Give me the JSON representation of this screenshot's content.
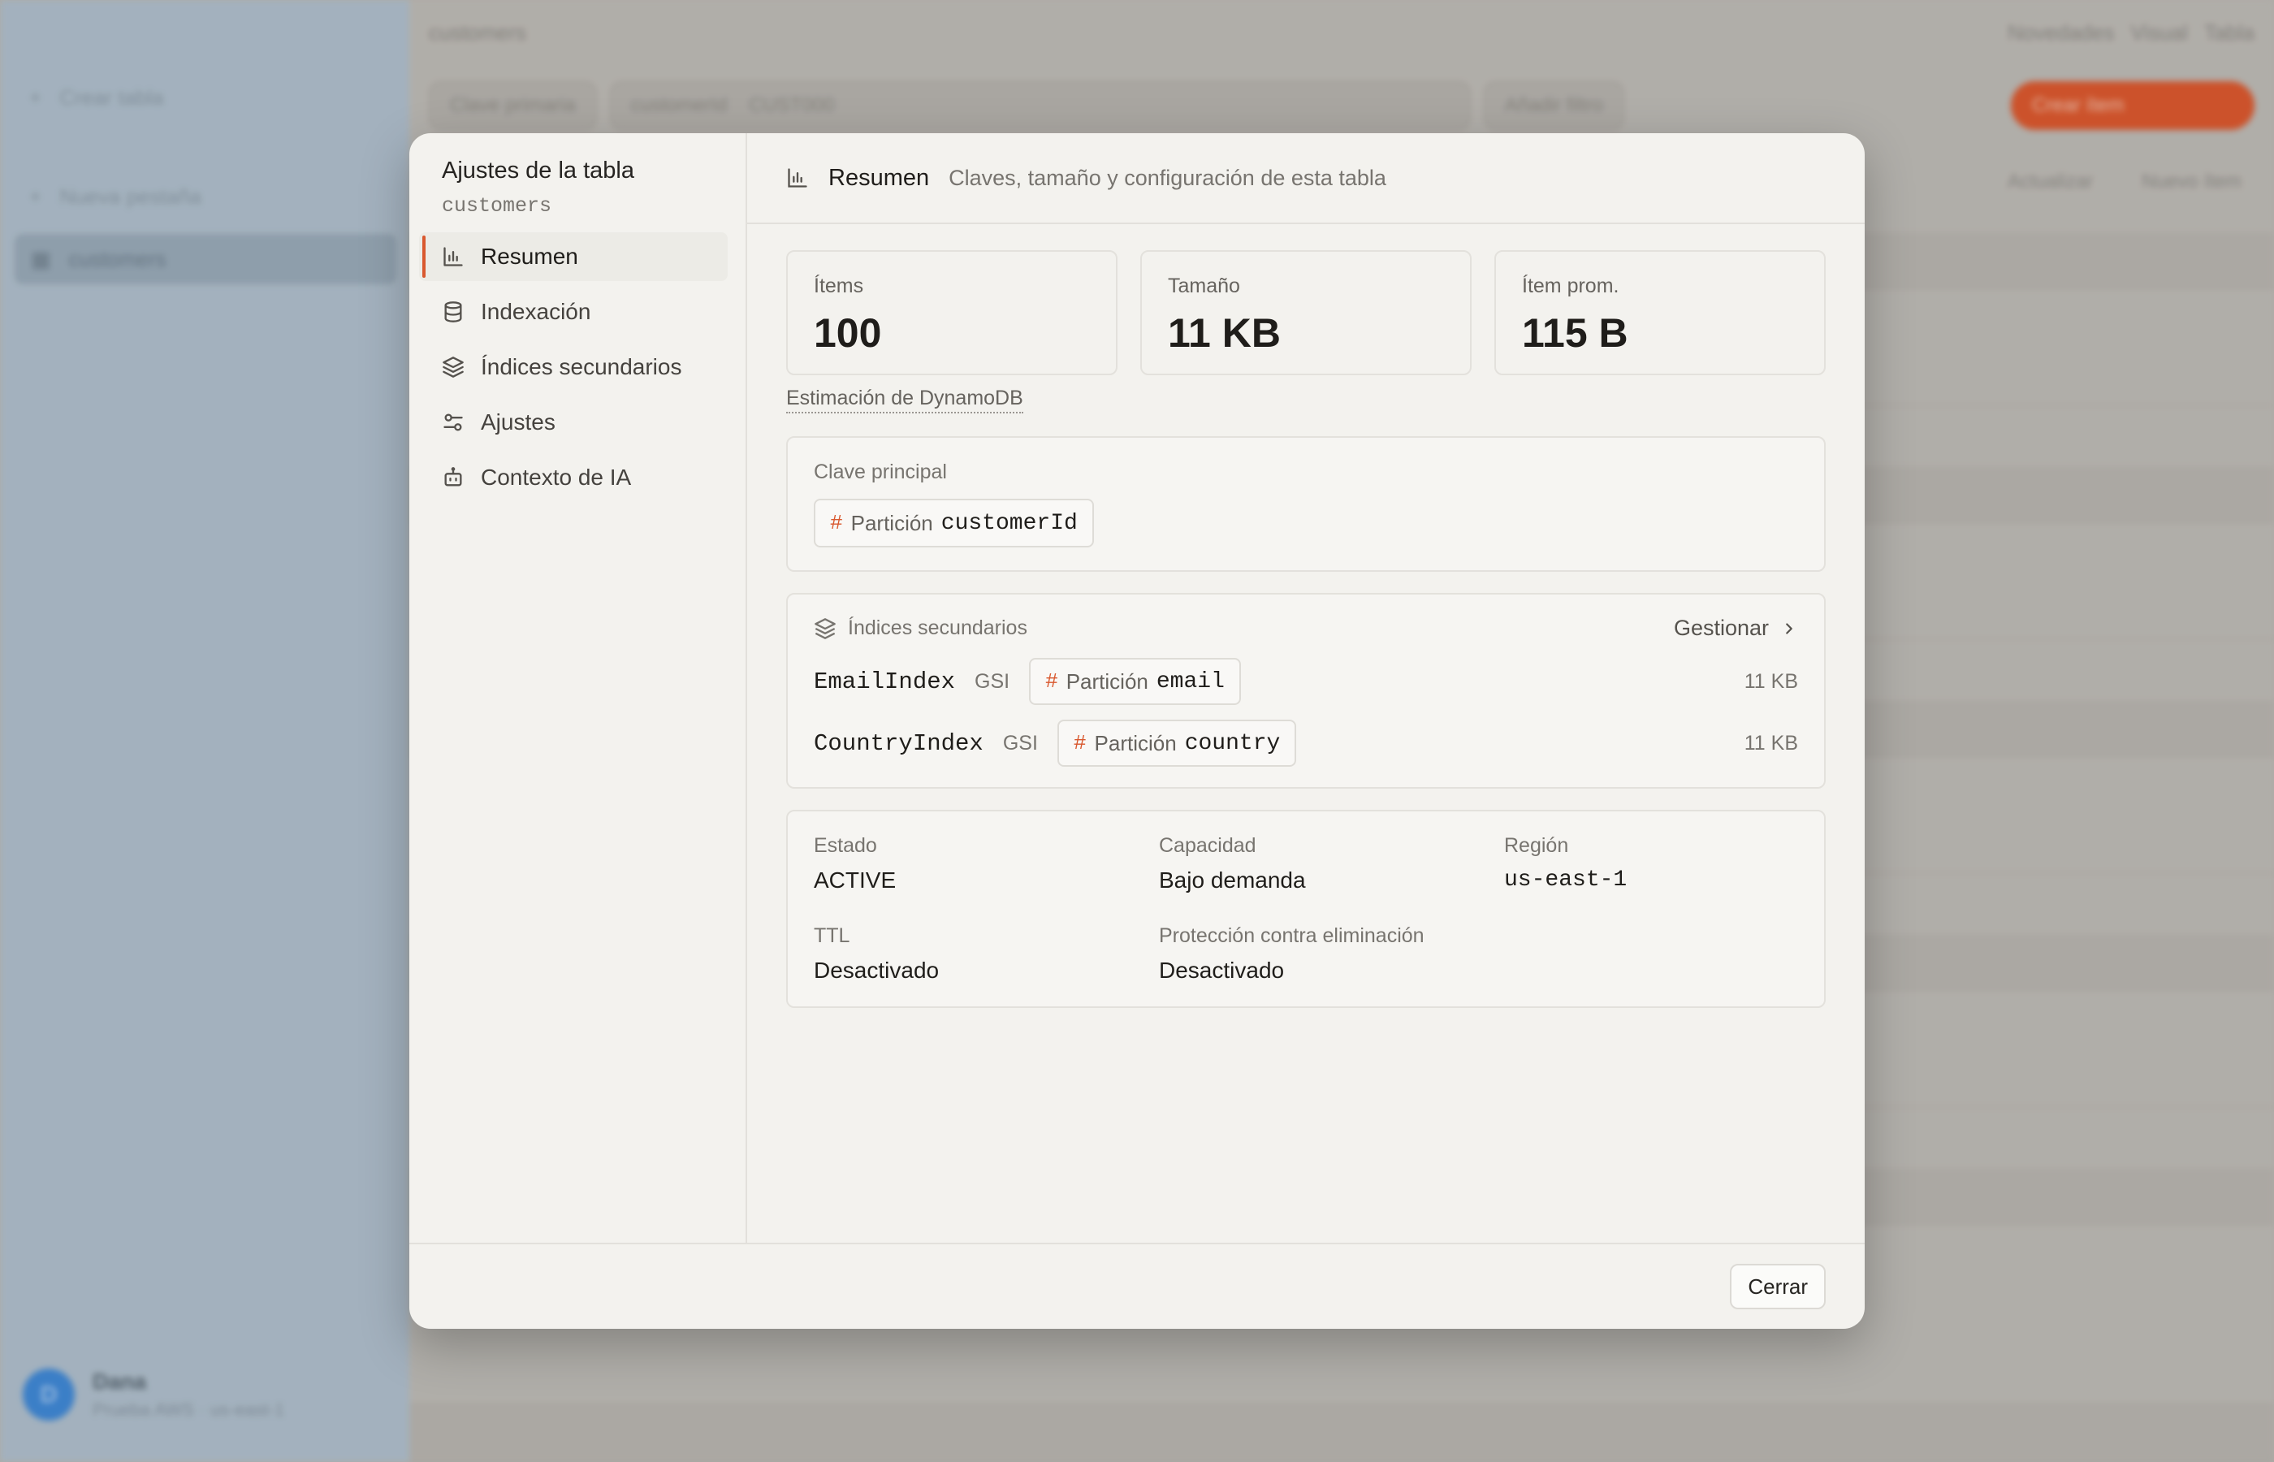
{
  "background": {
    "sidebar": {
      "items": [
        "Crear tabla",
        "Nueva pestaña",
        "customers"
      ],
      "user_name": "Dana",
      "user_sub": "Prueba AWS · us-east-1",
      "avatar_initial": "D"
    },
    "topbar": {
      "table_name": "customers",
      "links": [
        "Novedades",
        "Visual",
        "Tabla"
      ]
    },
    "toolbar": {
      "key_select": "Clave primaria",
      "query_key": "customerId",
      "query_value": "CUST000",
      "filter": "Añadir filtro",
      "create_button": "Crear ítem"
    },
    "actions": [
      "Actualizar",
      "Nuevo ítem"
    ]
  },
  "modal": {
    "sidebar": {
      "title": "Ajustes de la tabla",
      "table": "customers",
      "items": [
        {
          "label": "Resumen",
          "icon": "bar-chart-icon",
          "active": true
        },
        {
          "label": "Indexación",
          "icon": "database-icon",
          "active": false
        },
        {
          "label": "Índices secundarios",
          "icon": "layers-icon",
          "active": false
        },
        {
          "label": "Ajustes",
          "icon": "sliders-icon",
          "active": false
        },
        {
          "label": "Contexto de IA",
          "icon": "bot-icon",
          "active": false
        }
      ]
    },
    "header": {
      "title": "Resumen",
      "subtitle": "Claves, tamaño y configuración de esta tabla"
    },
    "stats": [
      {
        "label": "Ítems",
        "value": "100"
      },
      {
        "label": "Tamaño",
        "value": "11 KB"
      },
      {
        "label": "Ítem prom.",
        "value": "115 B"
      }
    ],
    "estimate_note": "Estimación de DynamoDB",
    "primary_key": {
      "label": "Clave principal",
      "key_type": "Partición",
      "attribute": "customerId"
    },
    "secondary_indexes": {
      "label": "Índices secundarios",
      "manage_label": "Gestionar",
      "items": [
        {
          "name": "EmailIndex",
          "type": "GSI",
          "key_type": "Partición",
          "attribute": "email",
          "size": "11 KB"
        },
        {
          "name": "CountryIndex",
          "type": "GSI",
          "key_type": "Partición",
          "attribute": "country",
          "size": "11 KB"
        }
      ]
    },
    "details": {
      "status_label": "Estado",
      "status_value": "ACTIVE",
      "capacity_label": "Capacidad",
      "capacity_value": "Bajo demanda",
      "region_label": "Región",
      "region_value": "us-east-1",
      "ttl_label": "TTL",
      "ttl_value": "Desactivado",
      "protection_label": "Protección contra eliminación",
      "protection_value": "Desactivado"
    },
    "footer": {
      "close_label": "Cerrar"
    }
  },
  "colors": {
    "accent": "#d9582e",
    "modal_bg": "#f3f2ee"
  }
}
